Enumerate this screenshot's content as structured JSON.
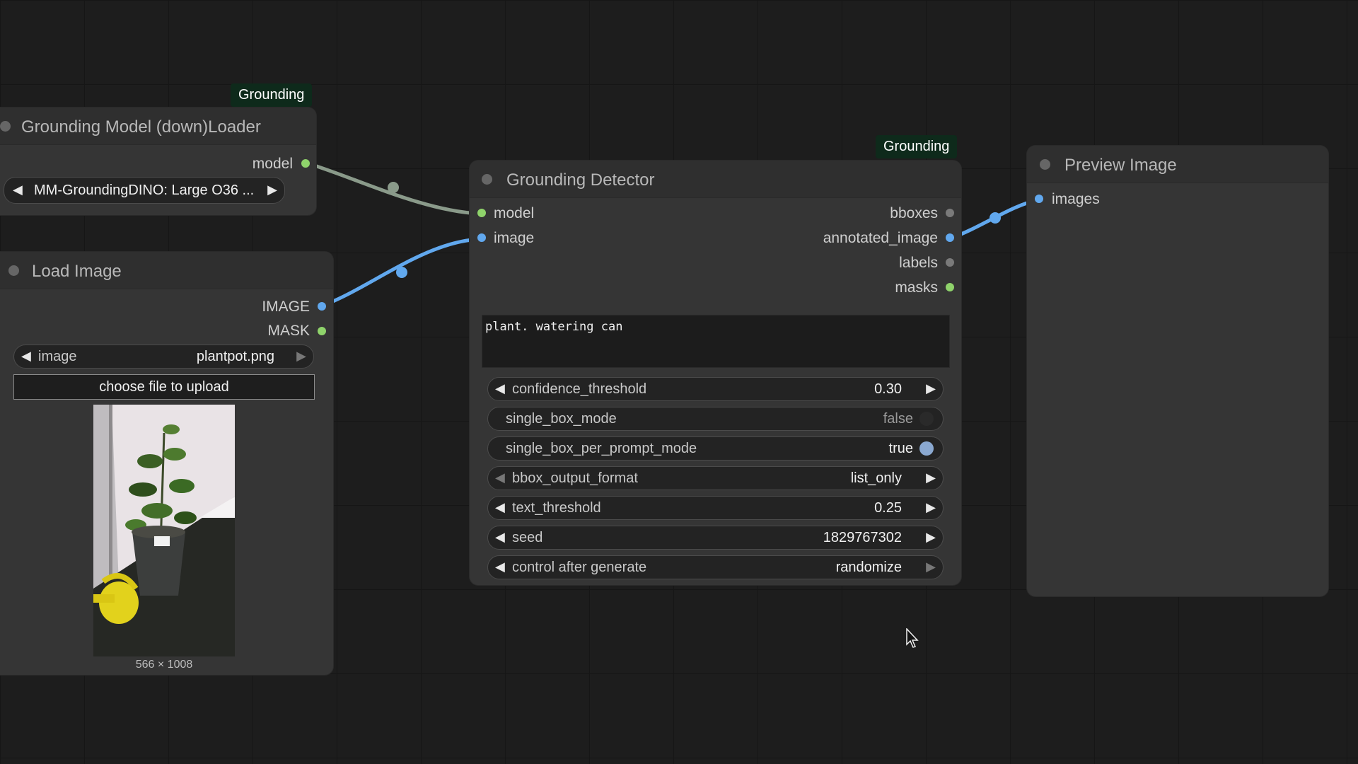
{
  "loader": {
    "badge": "Grounding",
    "title": "Grounding Model (down)Loader",
    "output_model": "model",
    "model_select": "MM-GroundingDINO: Large O36 ..."
  },
  "load_image": {
    "title": "Load Image",
    "output_image": "IMAGE",
    "output_mask": "MASK",
    "image_label": "image",
    "image_value": "plantpot.png",
    "upload_label": "choose file to upload",
    "preview_size": "566 × 1008"
  },
  "detector": {
    "badge": "Grounding",
    "title": "Grounding Detector",
    "inputs": [
      "model",
      "image"
    ],
    "outputs": [
      "bboxes",
      "annotated_image",
      "labels",
      "masks"
    ],
    "prompt": "plant. watering can",
    "widgets": {
      "confidence_threshold": {
        "label": "confidence_threshold",
        "value": "0.30"
      },
      "single_box_mode": {
        "label": "single_box_mode",
        "value": "false"
      },
      "single_box_per_prompt_mode": {
        "label": "single_box_per_prompt_mode",
        "value": "true"
      },
      "bbox_output_format": {
        "label": "bbox_output_format",
        "value": "list_only"
      },
      "text_threshold": {
        "label": "text_threshold",
        "value": "0.25"
      },
      "seed": {
        "label": "seed",
        "value": "1829767302"
      },
      "control_after_generate": {
        "label": "control after generate",
        "value": "randomize"
      }
    }
  },
  "preview": {
    "title": "Preview Image",
    "input_images": "images"
  },
  "colors": {
    "canvas": "#1d1d1d",
    "node_body": "#353535",
    "model_wire": "#8a9a8a",
    "image_wire": "#61a8ee",
    "model_slot": "#8fd36b",
    "image_slot": "#61a8ee",
    "badge_bg": "#0e2a1b"
  },
  "icons": {
    "left_arrow": "◀",
    "right_arrow": "▶"
  }
}
